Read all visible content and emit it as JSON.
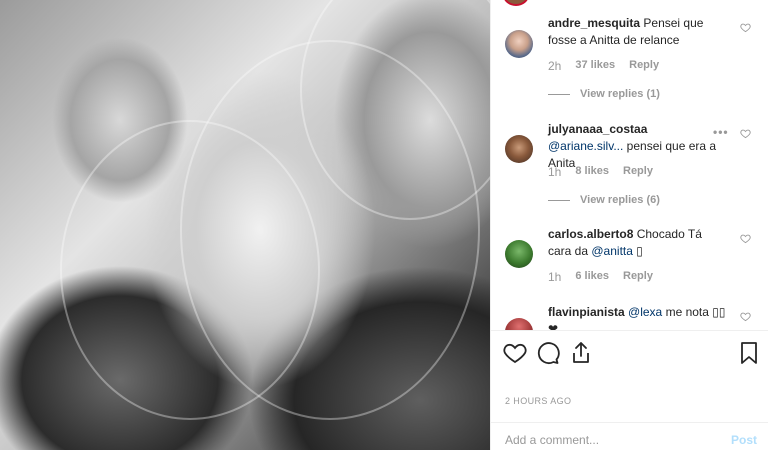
{
  "post": {
    "image_alt": "black and white portrait photo",
    "date_label": "2 HOURS AGO",
    "add_comment_placeholder": "Add a comment...",
    "post_label": "Post"
  },
  "comments": [
    {
      "username": "andre_mesquita",
      "text": "Pensei que fosse a Anitta de relance",
      "time": "2h",
      "likes": "37 likes",
      "reply": "Reply",
      "view_replies": "View replies (1)"
    },
    {
      "username": "julyanaaa_costaa",
      "mention": "@ariane.silv...",
      "text": "pensei que era a Anita",
      "time": "1h",
      "likes": "8 likes",
      "reply": "Reply",
      "view_replies": "View replies (6)",
      "more": "•••"
    },
    {
      "username": "carlos.alberto8",
      "text": "Chocado Tá cara da",
      "mention": "@anitta",
      "emoji": "▯",
      "time": "1h",
      "likes": "6 likes",
      "reply": "Reply"
    },
    {
      "username": "flavinpianista",
      "mention": "@lexa",
      "text": "me nota",
      "emoji": "▯▯ ❤"
    }
  ],
  "colors": {
    "mention": "#003569",
    "muted": "#999999",
    "post_disabled": "#b2dffc",
    "border": "#efefef"
  },
  "icons": [
    "heart-icon",
    "comment-icon",
    "share-icon",
    "bookmark-icon",
    "small-heart-icon"
  ]
}
